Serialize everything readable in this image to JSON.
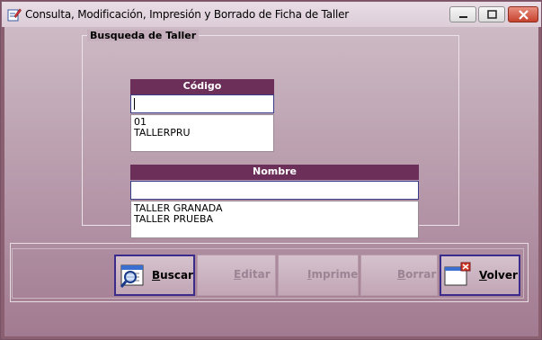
{
  "window": {
    "title": "Consulta, Modificación, Impresión y Borrado de Ficha de Taller",
    "icon": "edit-form-icon"
  },
  "search_group": {
    "legend": "Busqueda de Taller",
    "codigo": {
      "header": "Código",
      "input_value": "",
      "items": [
        "01",
        "TALLERPRU"
      ]
    },
    "nombre": {
      "header": "Nombre",
      "input_value": "",
      "items": [
        "TALLER GRANADA",
        "TALLER PRUEBA"
      ]
    }
  },
  "toolbar": {
    "buscar": {
      "first": "B",
      "rest": "uscar",
      "icon": "search-list-icon",
      "enabled": true
    },
    "editar": {
      "first": "E",
      "rest": "ditar",
      "enabled": false
    },
    "imprime": {
      "first": "I",
      "rest": "mprime",
      "enabled": false
    },
    "borrar": {
      "first": "B",
      "rest": "orrar",
      "enabled": false
    },
    "volver": {
      "first": "V",
      "rest": "olver",
      "icon": "close-window-icon",
      "enabled": true
    }
  },
  "colors": {
    "header_bg": "#6b2f59",
    "accent_border": "#3b2b8a"
  }
}
